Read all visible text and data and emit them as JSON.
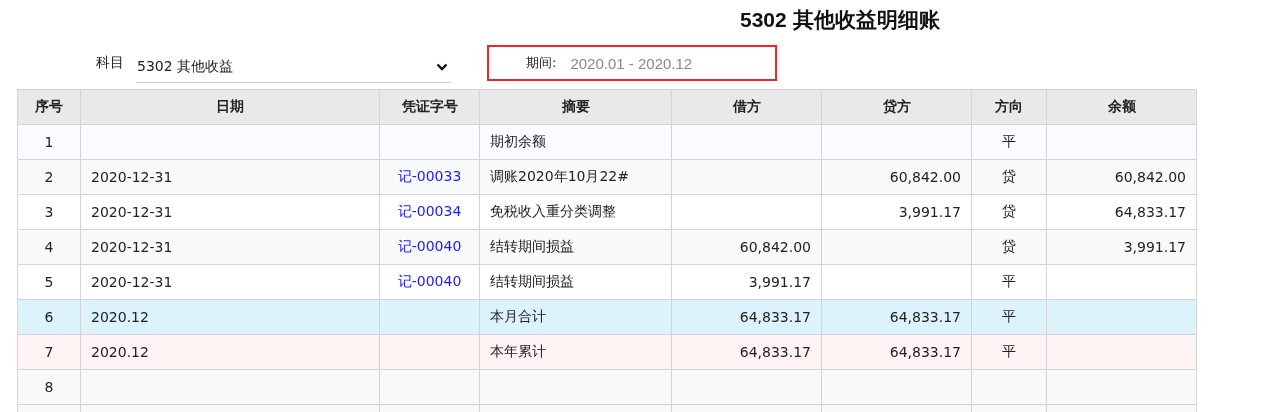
{
  "title": "5302 其他收益明细账",
  "subject": {
    "label": "科目",
    "value": "5302 其他收益"
  },
  "period": {
    "label": "期间:",
    "value": "2020.01 - 2020.12"
  },
  "table": {
    "columns": [
      "序号",
      "日期",
      "凭证字号",
      "摘要",
      "借方",
      "贷方",
      "方向",
      "余额"
    ],
    "rows": [
      {
        "kind": "opening",
        "no": "1",
        "date": "",
        "voucher": "",
        "summary": "期初余额",
        "debit": "",
        "credit": "",
        "direction": "平",
        "balance": ""
      },
      {
        "kind": "entry",
        "no": "2",
        "date": "2020-12-31",
        "voucher": "记-00033",
        "summary": "调账2020年10月22#",
        "debit": "",
        "credit": "60,842.00",
        "direction": "贷",
        "balance": "60,842.00"
      },
      {
        "kind": "entry",
        "no": "3",
        "date": "2020-12-31",
        "voucher": "记-00034",
        "summary": "免税收入重分类调整",
        "debit": "",
        "credit": "3,991.17",
        "direction": "贷",
        "balance": "64,833.17"
      },
      {
        "kind": "entry",
        "no": "4",
        "date": "2020-12-31",
        "voucher": "记-00040",
        "summary": "结转期间损益",
        "debit": "60,842.00",
        "credit": "",
        "direction": "贷",
        "balance": "3,991.17"
      },
      {
        "kind": "entry",
        "no": "5",
        "date": "2020-12-31",
        "voucher": "记-00040",
        "summary": "结转期间损益",
        "debit": "3,991.17",
        "credit": "",
        "direction": "平",
        "balance": ""
      },
      {
        "kind": "month_total",
        "no": "6",
        "date": "2020.12",
        "voucher": "",
        "summary": "本月合计",
        "debit": "64,833.17",
        "credit": "64,833.17",
        "direction": "平",
        "balance": ""
      },
      {
        "kind": "year_total",
        "no": "7",
        "date": "2020.12",
        "voucher": "",
        "summary": "本年累计",
        "debit": "64,833.17",
        "credit": "64,833.17",
        "direction": "平",
        "balance": ""
      },
      {
        "kind": "blank",
        "no": "8",
        "date": "",
        "voucher": "",
        "summary": "",
        "debit": "",
        "credit": "",
        "direction": "",
        "balance": ""
      }
    ]
  }
}
